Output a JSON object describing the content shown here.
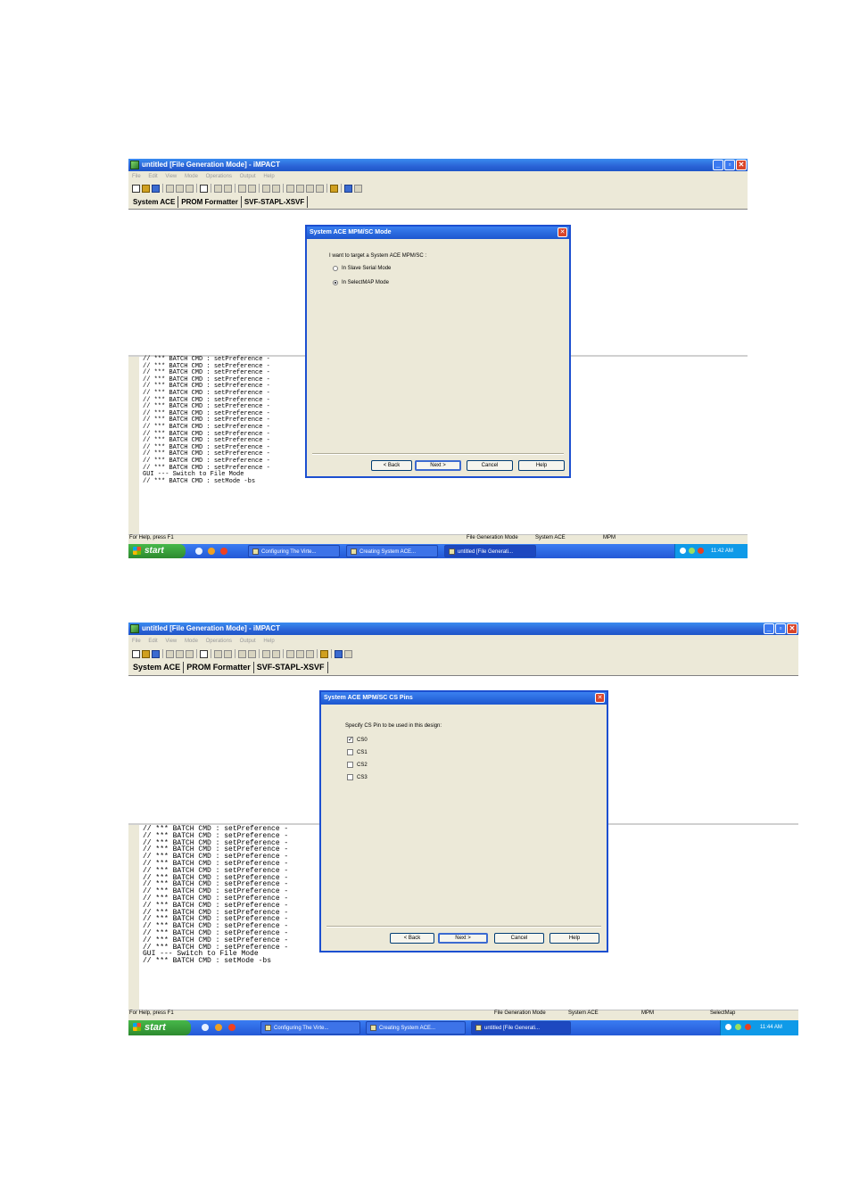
{
  "screenshots": [
    {
      "window_title": "untitled [File Generation Mode] - iMPACT",
      "menu": [
        "File",
        "Edit",
        "View",
        "Mode",
        "Operations",
        "Output",
        "Help"
      ],
      "tabs": [
        "System ACE",
        "PROM Formatter",
        "SVF-STAPL-XSVF"
      ],
      "log_lines": [
        "// *** BATCH CMD : setPreference -",
        "// *** BATCH CMD : setPreference -",
        "// *** BATCH CMD : setPreference -",
        "// *** BATCH CMD : setPreference -",
        "// *** BATCH CMD : setPreference -",
        "// *** BATCH CMD : setPreference -",
        "// *** BATCH CMD : setPreference -",
        "// *** BATCH CMD : setPreference -",
        "// *** BATCH CMD : setPreference -",
        "// *** BATCH CMD : setPreference -",
        "// *** BATCH CMD : setPreference -",
        "// *** BATCH CMD : setPreference -",
        "// *** BATCH CMD : setPreference -",
        "// *** BATCH CMD : setPreference -",
        "// *** BATCH CMD : setPreference -",
        "// *** BATCH CMD : setPreference -",
        "// *** BATCH CMD : setPreference -",
        "GUI --- Switch to File Mode",
        "// *** BATCH CMD : setMode -bs"
      ],
      "status": {
        "help": "For Help, press F1",
        "mode": "File Generation Mode",
        "target": "System ACE",
        "type": "MPM",
        "extra": ""
      },
      "taskbar": {
        "start": "start",
        "tasks": [
          "Configuring The Virte...",
          "Creating System ACE...",
          "untitled [File Generati..."
        ],
        "clock": "11:42 AM"
      },
      "dialog": {
        "title": "System ACE MPM/SC Mode",
        "prompt": "I want to target a System ACE MPM/SC :",
        "options": [
          {
            "label": "In Slave Serial Mode",
            "selected": false
          },
          {
            "label": "In SelectMAP Mode",
            "selected": true
          }
        ],
        "buttons": {
          "back": "< Back",
          "next": "Next >",
          "cancel": "Cancel",
          "help": "Help"
        }
      }
    },
    {
      "window_title": "untitled [File Generation Mode] - iMPACT",
      "menu": [
        "File",
        "Edit",
        "View",
        "Mode",
        "Operations",
        "Output",
        "Help"
      ],
      "tabs": [
        "System ACE",
        "PROM Formatter",
        "SVF-STAPL-XSVF"
      ],
      "log_lines": [
        "// *** BATCH CMD : setPreference -",
        "// *** BATCH CMD : setPreference -",
        "// *** BATCH CMD : setPreference -",
        "// *** BATCH CMD : setPreference -",
        "// *** BATCH CMD : setPreference -",
        "// *** BATCH CMD : setPreference -",
        "// *** BATCH CMD : setPreference -",
        "// *** BATCH CMD : setPreference -",
        "// *** BATCH CMD : setPreference -",
        "// *** BATCH CMD : setPreference -",
        "// *** BATCH CMD : setPreference -",
        "// *** BATCH CMD : setPreference -",
        "// *** BATCH CMD : setPreference -",
        "// *** BATCH CMD : setPreference -",
        "// *** BATCH CMD : setPreference -",
        "// *** BATCH CMD : setPreference -",
        "// *** BATCH CMD : setPreference -",
        "// *** BATCH CMD : setPreference -",
        "GUI --- Switch to File Mode",
        "// *** BATCH CMD : setMode -bs"
      ],
      "status": {
        "help": "For Help, press F1",
        "mode": "File Generation Mode",
        "target": "System ACE",
        "type": "MPM",
        "extra": "SelectMap"
      },
      "taskbar": {
        "start": "start",
        "tasks": [
          "Configuring The Virte...",
          "Creating System ACE...",
          "untitled [File Generati..."
        ],
        "clock": "11:44 AM"
      },
      "dialog": {
        "title": "System ACE MPM/SC CS Pins",
        "prompt": "Specify CS Pin to be used in this design:",
        "options": [
          {
            "label": "CS0",
            "checked": true
          },
          {
            "label": "CS1",
            "checked": false
          },
          {
            "label": "CS2",
            "checked": false
          },
          {
            "label": "CS3",
            "checked": false
          }
        ],
        "buttons": {
          "back": "< Back",
          "next": "Next >",
          "cancel": "Cancel",
          "help": "Help"
        }
      }
    }
  ],
  "icons": {
    "app": "impact-app-icon",
    "window_controls": [
      "minimize-icon",
      "restore-icon",
      "close-icon"
    ],
    "start": "windows-flag-icon",
    "colors": {
      "titlebar": "#2a63d6",
      "taskbar": "#2459d6",
      "start_button": "#2d8a2f",
      "tray": "#0f9ae8"
    }
  }
}
